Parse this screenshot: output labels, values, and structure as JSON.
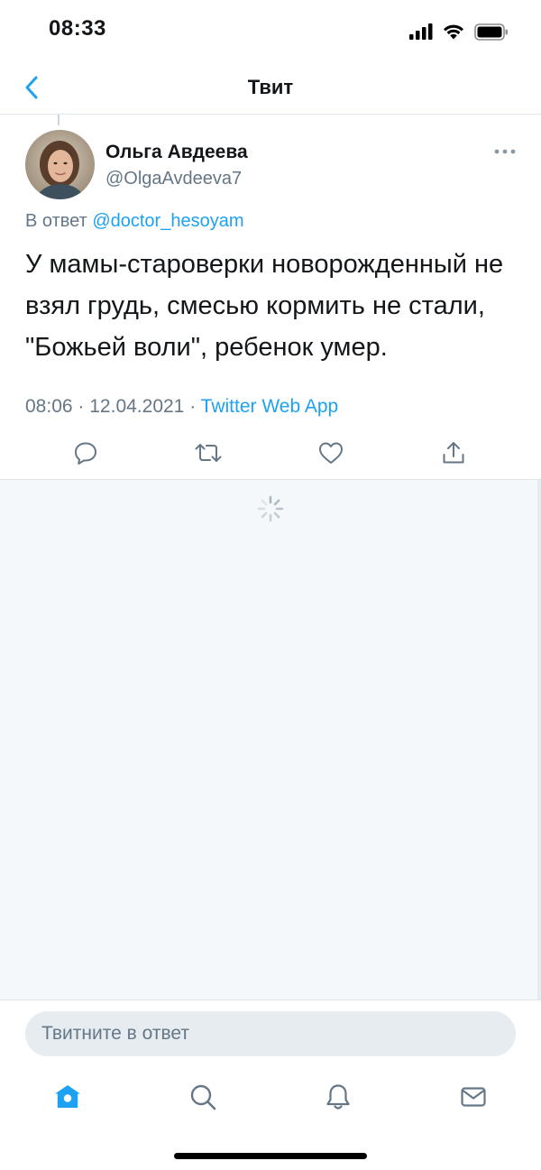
{
  "status_bar": {
    "time": "08:33"
  },
  "nav": {
    "title": "Твит"
  },
  "tweet": {
    "author_name": "Ольга Авдеева",
    "author_handle": "@OlgaAvdeeva7",
    "reply_prefix": "В ответ",
    "reply_to": "@doctor_hesoyam",
    "text": "У мамы-староверки новорожденный не взял грудь, смесью кормить не стали, \"Божьей воли\", ребенок умер.",
    "time": "08:06",
    "date": "12.04.2021",
    "separator": "·",
    "source_app": "Twitter Web App"
  },
  "reply_composer": {
    "placeholder": "Твитните в ответ"
  },
  "colors": {
    "accent": "#1da1f2",
    "action_icon": "#657786",
    "secondary_text": "#657786",
    "replies_background": "#f5f8fa"
  },
  "tab_bar": {
    "items": [
      {
        "name": "home",
        "icon": "home-icon",
        "active": true
      },
      {
        "name": "search",
        "icon": "search-icon",
        "active": false
      },
      {
        "name": "notifications",
        "icon": "bell-icon",
        "active": false
      },
      {
        "name": "messages",
        "icon": "mail-icon",
        "active": false
      }
    ]
  }
}
